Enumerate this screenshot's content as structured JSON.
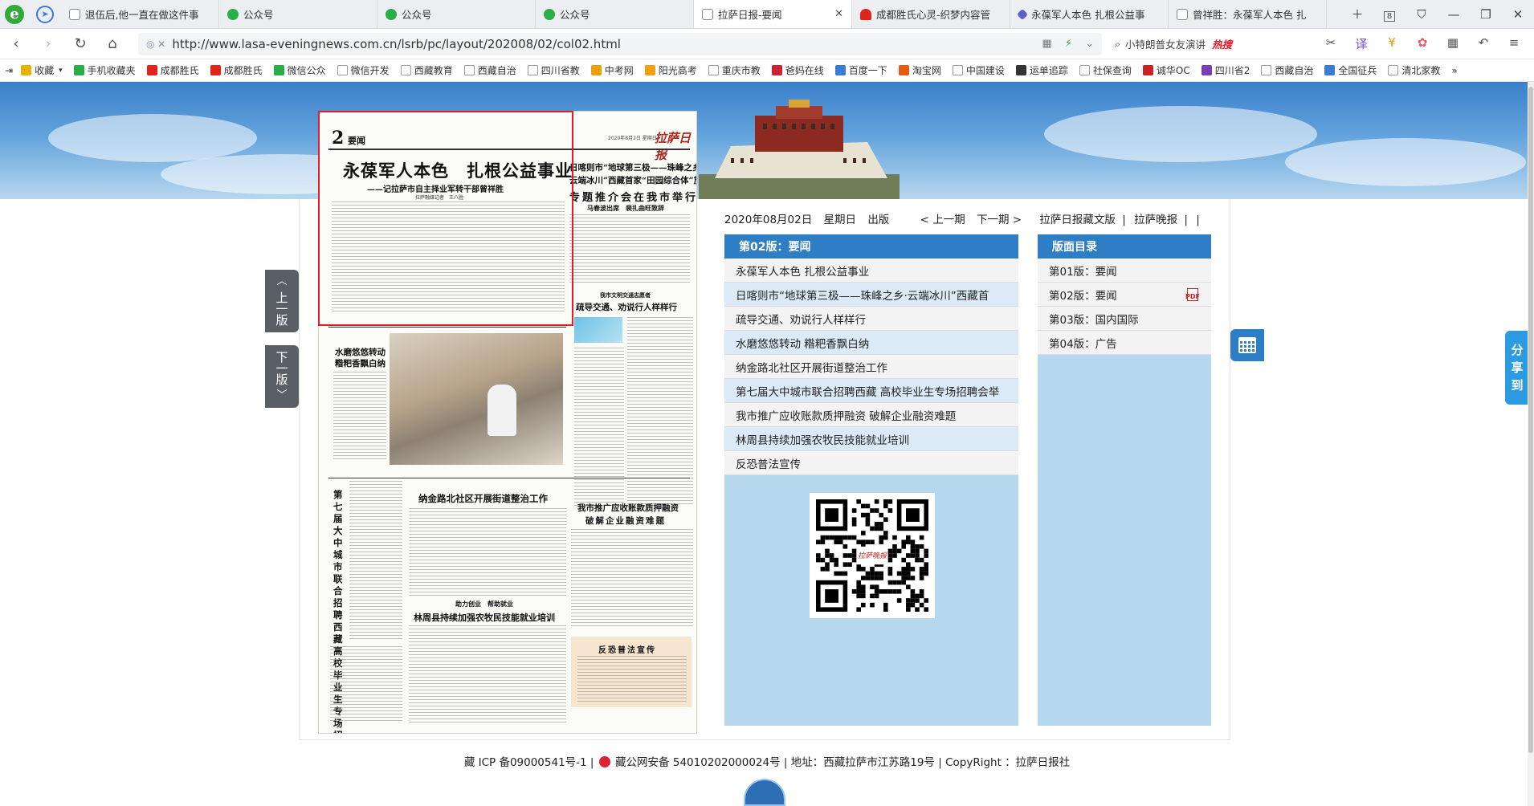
{
  "browser": {
    "tabs": [
      {
        "title": "退伍后,他一直在做这件事",
        "icon": "page-icon",
        "active": false
      },
      {
        "title": "公众号",
        "icon": "wechat-icon",
        "active": false
      },
      {
        "title": "公众号",
        "icon": "wechat-icon",
        "active": false
      },
      {
        "title": "公众号",
        "icon": "wechat-icon",
        "active": false
      },
      {
        "title": "拉萨日报-要闻",
        "icon": "page-icon",
        "active": true
      },
      {
        "title": "成都胜氏心灵-织梦内容管",
        "icon": "heart-icon",
        "active": false
      },
      {
        "title": "永葆军人本色 扎根公益事",
        "icon": "diamond-icon",
        "active": false
      },
      {
        "title": "曾祥胜：永葆军人本色 扎",
        "icon": "page-icon",
        "active": false
      }
    ],
    "tab_count": "8",
    "url": "http://www.lasa-eveningnews.com.cn/lsrb/pc/layout/202008/02/col02.html",
    "search_text": "小特朗普女友演讲",
    "search_badge": "热搜",
    "bookmarks": [
      "收藏",
      "手机收藏夹",
      "成都胜氏",
      "成都胜氏",
      "微信公众",
      "微信开发",
      "西藏教育",
      "西藏自治",
      "四川省教",
      "中考网",
      "阳光高考",
      "重庆市教",
      "爸妈在线",
      "百度一下",
      "淘宝网",
      "中国建设",
      "运单追踪",
      "社保查询",
      "诚华OC",
      "四川省2",
      "西藏自治",
      "全国征兵",
      "清北家教"
    ]
  },
  "page": {
    "side_prev": [
      "上",
      "一",
      "版"
    ],
    "side_next": [
      "下",
      "一",
      "版"
    ],
    "date": "2020年08月02日",
    "weekday": "星期日",
    "publish": "出版",
    "prev_issue": "< 上一期",
    "next_issue": "下一期 >",
    "archive_link": "拉萨日报藏文版",
    "evening_link": "拉萨晚报",
    "separator": "|",
    "edition_title": "第02版：要闻",
    "articles": [
      "永葆军人本色 扎根公益事业",
      "日喀则市“地球第三极——珠峰之乡·云端冰川”西藏首",
      "疏导交通、劝说行人样样行",
      "水磨悠悠转动 糌粑香飘白纳",
      "纳金路北社区开展街道整治工作",
      "第七届大中城市联合招聘西藏 高校毕业生专场招聘会举",
      "我市推广应收账款质押融资 破解企业融资难题",
      "林周县持续加强农牧民技能就业培训",
      "反恐普法宣传"
    ],
    "toc_title": "版面目录",
    "toc": [
      "第01版：要闻",
      "第02版：要闻",
      "第03版：国内国际",
      "第04版：广告"
    ],
    "share": [
      "分",
      "享",
      "到"
    ],
    "footer": {
      "icp": "藏 ICP 备09000541号-1",
      "police": "藏公网安备 54010202000024号",
      "address": "地址：西藏拉萨市江苏路19号",
      "copyright": "CopyRight ：拉萨日报社"
    }
  },
  "newspaper": {
    "page_no": "2",
    "section": "要闻",
    "masthead": "拉萨日报",
    "date_small": "2020年8月2日 星期日",
    "headline": "永葆军人本色　扎根公益事业",
    "subhead": "——记拉萨市自主择业军转干部曾祥胜",
    "byline": "拉萨融媒记者　王八胜",
    "right_headline_1": "日喀则市“地球第三极——珠峰之乡·",
    "right_headline_2": "云端冰川”西藏首家“田园综合体”旅游",
    "right_headline_3": "专题推介会在我市举行",
    "right_byline": "马春波出席　裴扎曲旺致辞",
    "traffic_kicker": "我市文明交通志愿者",
    "traffic_headline": "疏导交通、劝说行人样样行",
    "mill_headline_1": "水磨悠悠转动",
    "mill_headline_2": "糌粑香飘白纳",
    "vertical_headline": "第七届大中城市联合招聘西藏高校毕业生专场招聘会举行",
    "naijin_headline": "纳金路北社区开展街道整治工作",
    "finance_headline_1": "我市推广应收账款质押融资",
    "finance_headline_2": "破解企业融资难题",
    "linzhou_kicker": "助力创业　帮助就业",
    "linzhou_headline": "林周县持续加强农牧民技能就业培训",
    "antiterror_headline": "反恐普法宣传",
    "qr_caption": "拉萨晚报"
  },
  "colors": {
    "accent_blue": "#2d7ec4",
    "list_bg": "#b5d8ef",
    "highlight_red": "#e51c23",
    "side_btn_gray": "#5a5f66"
  }
}
